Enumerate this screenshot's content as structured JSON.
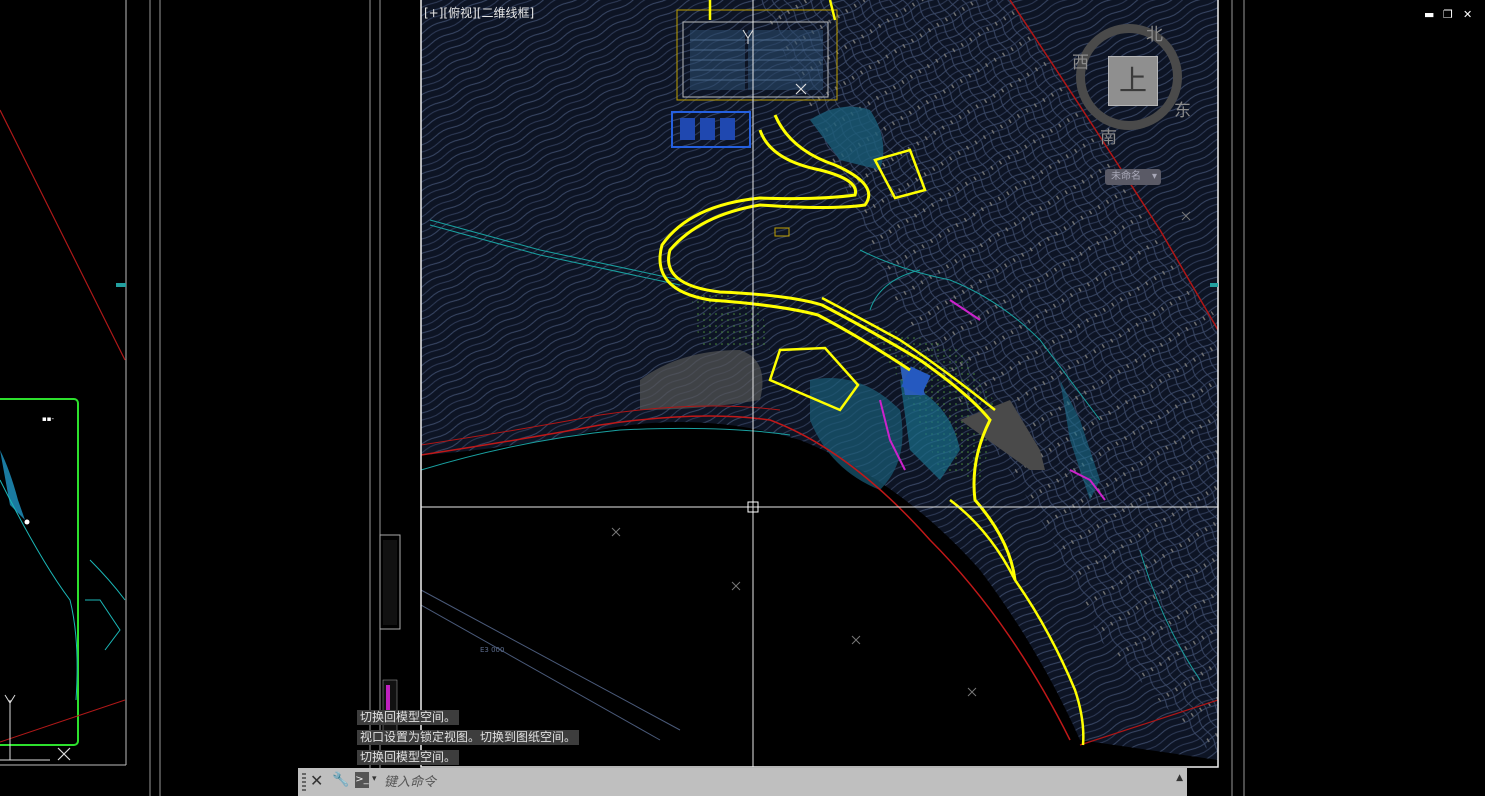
{
  "viewport": {
    "label": "[+][俯视][二维线框]",
    "compass": {
      "top_face": "上",
      "north": "北",
      "south": "南",
      "east": "东",
      "west": "西"
    },
    "ucs_dropdown": {
      "value": "未命名"
    },
    "axis_label": "Y"
  },
  "window_controls": {
    "minimize_icon": "minimize-icon",
    "restore_icon": "restore-icon",
    "close_icon": "close-icon"
  },
  "command_history": [
    "切换回模型空间。",
    "视口设置为锁定视图。切换到图纸空间。",
    "切换回模型空间。"
  ],
  "command_line": {
    "placeholder": "键入命令"
  },
  "colors": {
    "background": "#000000",
    "road": "#ffff00",
    "contour": "#3c4a6a",
    "boundary": "#c01818",
    "viewport_frame": "#ffffff",
    "selected_frame": "#22dd22",
    "water": "#1a6d8a",
    "magenta": "#cc22cc"
  }
}
